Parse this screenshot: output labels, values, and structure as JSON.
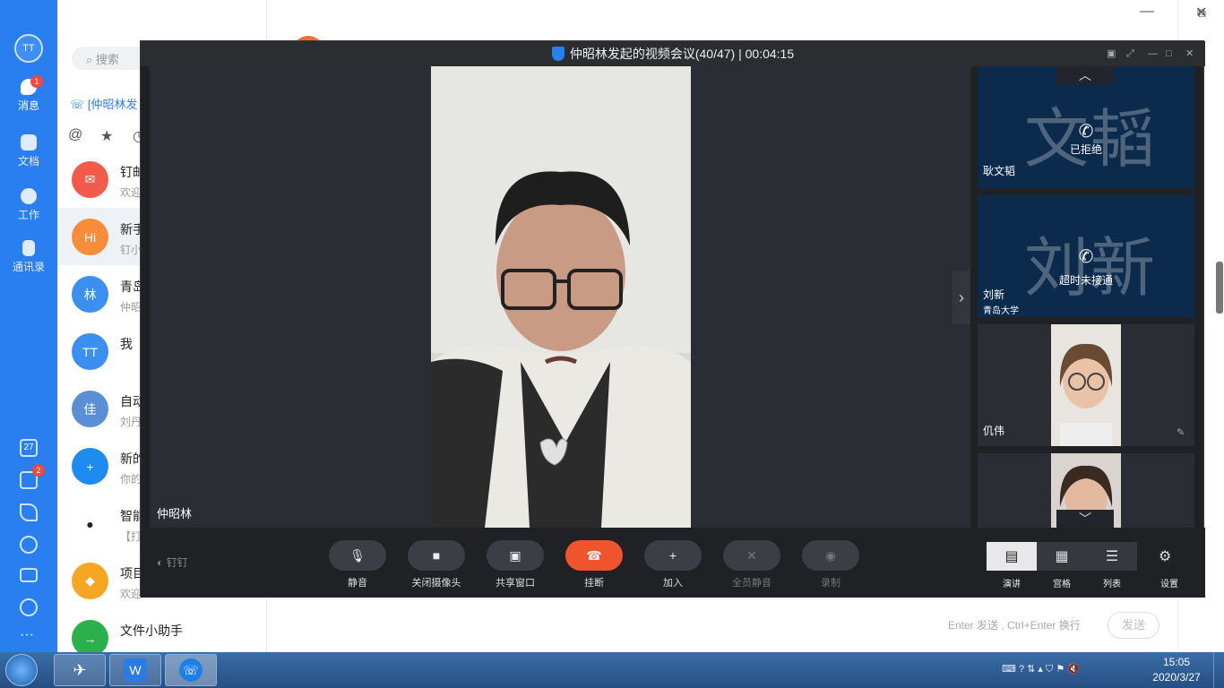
{
  "sidebar": {
    "avatar_text": "TT",
    "nav": [
      {
        "label": "消息",
        "badge": "1",
        "icon": "chat-bubble-icon"
      },
      {
        "label": "文档",
        "icon": "folder-icon"
      },
      {
        "label": "工作",
        "icon": "grid-icon"
      },
      {
        "label": "通讯录",
        "icon": "contacts-icon"
      }
    ],
    "bottom_icons": [
      "calendar-icon",
      "todo-icon",
      "ding-icon",
      "phone-icon",
      "mail-icon",
      "network-icon",
      "more-icon"
    ],
    "todo_badge": "2",
    "calendar_text": "27"
  },
  "chatlist": {
    "search_placeholder": "搜索",
    "meeting_banner": "[仲昭林发",
    "items": [
      {
        "title": "钉邮",
        "sub": "欢迎",
        "color": "#f25a4a",
        "avatar": "✉"
      },
      {
        "title": "新手",
        "sub": "钉小",
        "color": "#f78d3b",
        "avatar": "Hi"
      },
      {
        "title": "青岛",
        "sub": "仲昭",
        "color": "#3b8ff0",
        "avatar": "林"
      },
      {
        "title": "我（",
        "sub": "",
        "color": "#3b8ff0",
        "avatar": "TT"
      },
      {
        "title": "自动",
        "sub": "刘丹",
        "color": "#5a8fd6",
        "avatar": "佳"
      },
      {
        "title": "新的",
        "sub": "你的",
        "color": "#1e8bf0",
        "avatar": "+"
      },
      {
        "title": "智能",
        "sub": "【打",
        "color": "#ffffff",
        "avatar": "●"
      },
      {
        "title": "项目",
        "sub": "欢迎",
        "color": "#f6a623",
        "avatar": "◆"
      },
      {
        "title": "文件小助手",
        "sub": "",
        "color": "#2bb14c",
        "avatar": "→"
      }
    ]
  },
  "chat": {
    "input_hint": "Enter 发送 , Ctrl+Enter 换行",
    "send": "发送"
  },
  "meeting": {
    "title": "仲昭林发起的视频会议(40/47) | 00:04:15",
    "main_speaker": "仲昭林",
    "brand": "钉钉",
    "participants": [
      {
        "name": "耿文韬",
        "big": "文韬",
        "status": "已拒绝",
        "sub": ""
      },
      {
        "name": "刘新",
        "big": "刘新",
        "status": "超时未接通",
        "sub": "青岛大学"
      },
      {
        "name": "仉伟",
        "big": "",
        "status": "",
        "sub": ""
      }
    ],
    "controls": [
      "静音",
      "关闭摄像头",
      "共享窗口",
      "挂断",
      "加入",
      "全员静音",
      "录制"
    ],
    "views": [
      "演讲",
      "宫格",
      "列表"
    ],
    "settings": "设置"
  },
  "taskbar": {
    "time": "15:05",
    "date": "2020/3/27"
  },
  "colors": {
    "accent": "#2a7ff0",
    "hangup": "#f0542c",
    "tile": "#0c2a4c"
  }
}
